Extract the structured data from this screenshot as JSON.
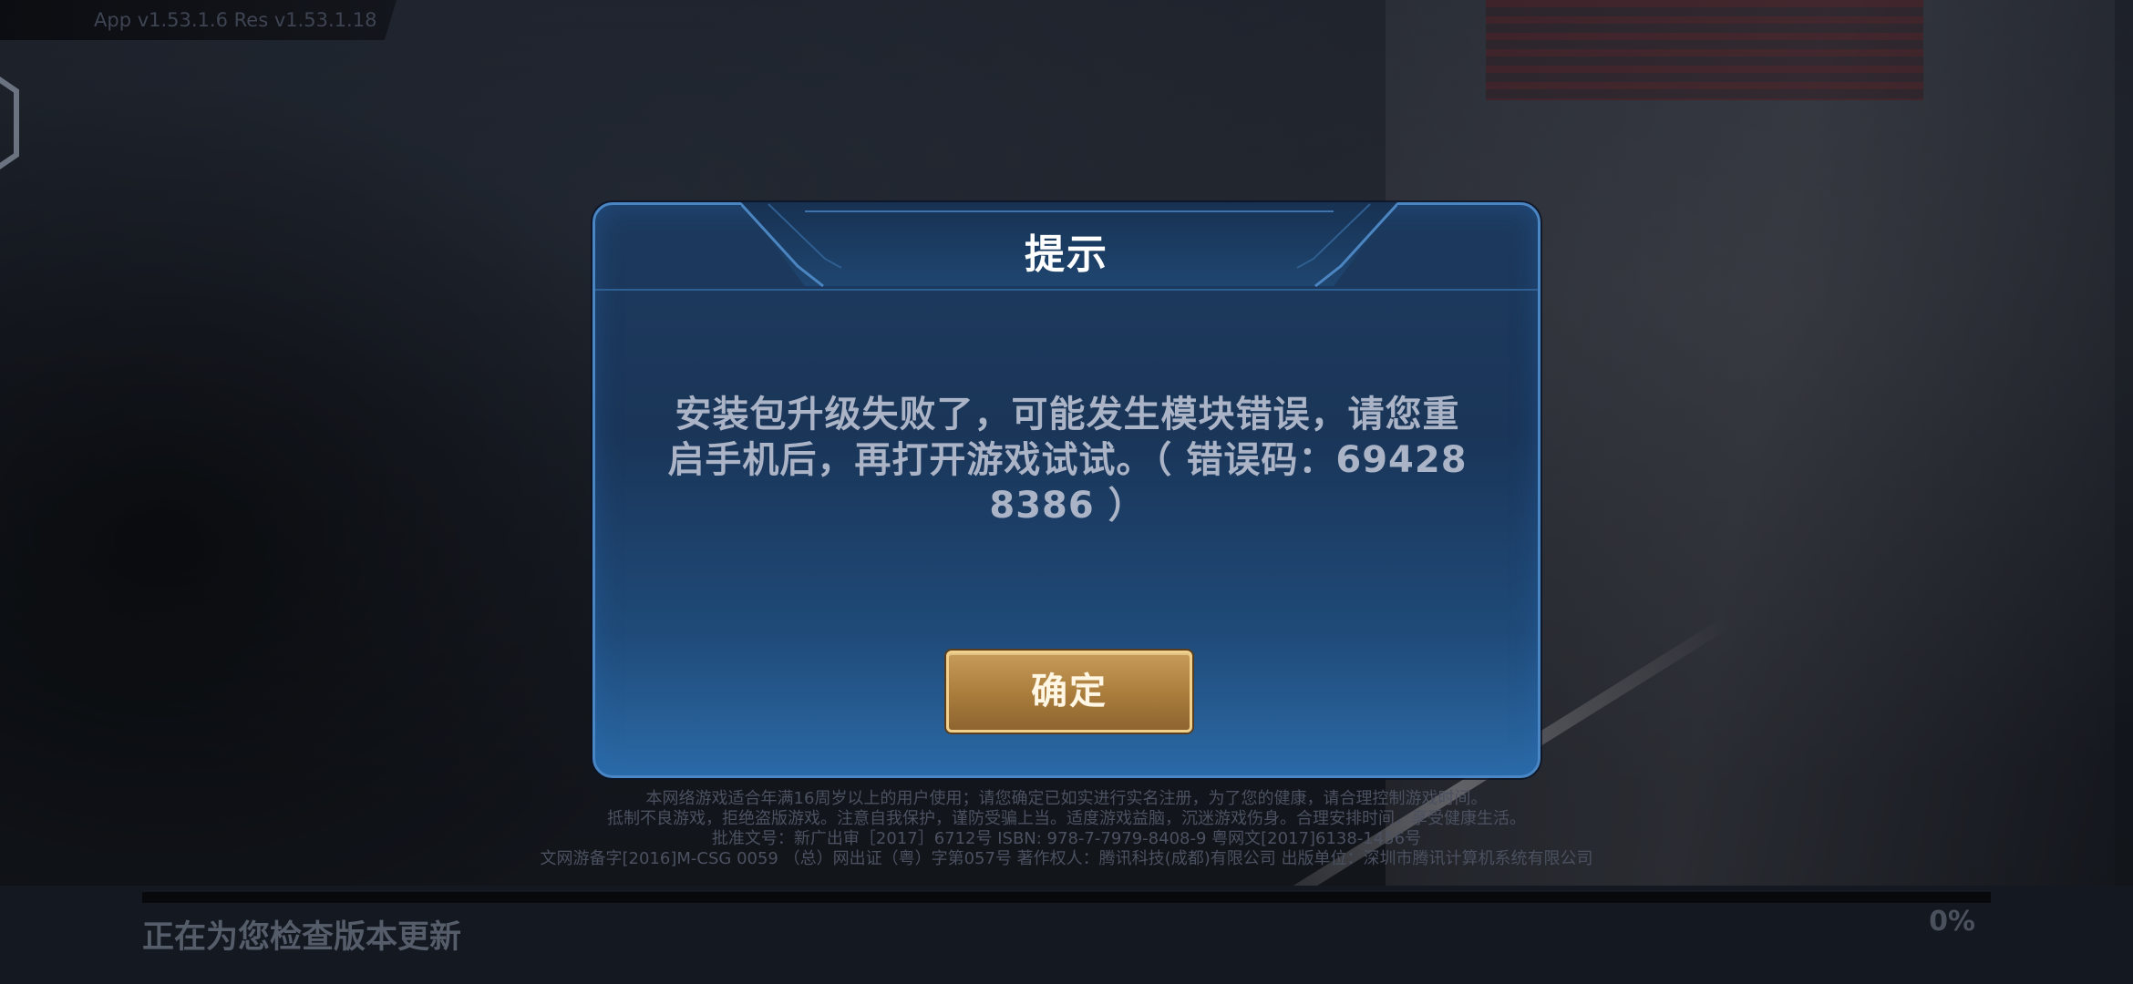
{
  "version_label": "App v1.53.1.6   Res v1.53.1.18",
  "dialog": {
    "title": "提示",
    "message_line1": "安装包升级失败了，可能发生模块错误，请您重",
    "message_line2_prefix": "启手机后，再打开游戏试试。（ 错误码：",
    "error_code_part1": "69428",
    "error_code_part2": "8386",
    "message_line3_suffix": " ）",
    "confirm_label": "确定"
  },
  "legal": [
    "本网络游戏适合年满16周岁以上的用户使用；请您确定已如实进行实名注册，为了您的健康，请合理控制游戏时间。",
    "抵制不良游戏，拒绝盗版游戏。注意自我保护，谨防受骗上当。适度游戏益脑，沉迷游戏伤身。合理安排时间，享受健康生活。",
    "批准文号：新广出审［2017］6712号  ISBN: 978-7-7979-8408-9  粤网文[2017]6138-1456号",
    "文网游备字[2016]M-CSG 0059 （总）网出证（粤）字第057号  著作权人：腾讯科技(成都)有限公司  出版单位：深圳市腾讯计算机系统有限公司"
  ],
  "bottom": {
    "status_text": "正在为您检查版本更新",
    "progress_label": "0%",
    "progress_fraction": 0
  },
  "colors": {
    "dialog_border": "#4a86c4",
    "button_gold": "#b88a48",
    "title": "#ffffff",
    "message": "#aab4c6"
  }
}
